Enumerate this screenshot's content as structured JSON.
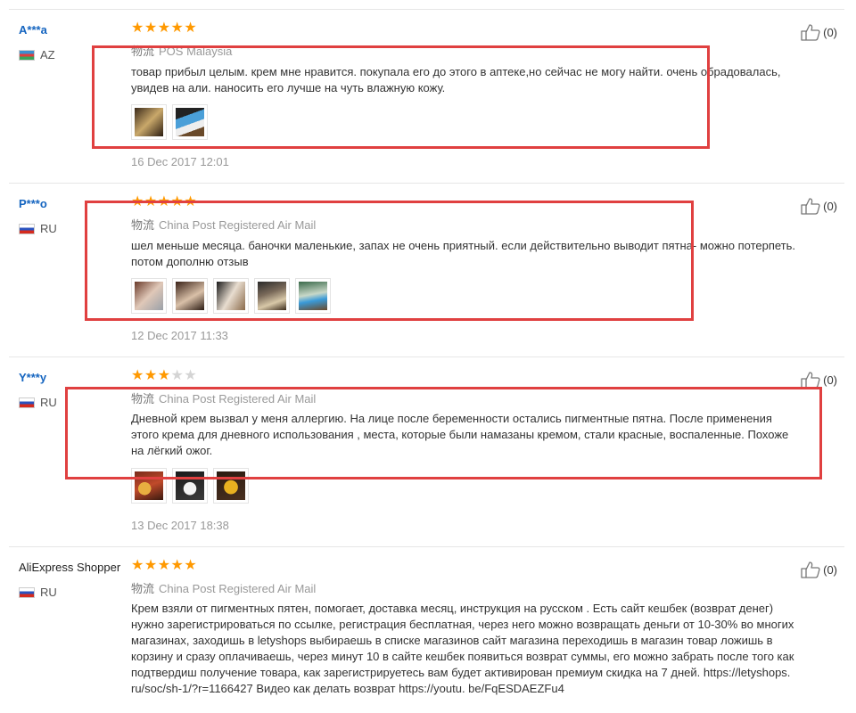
{
  "reviews": [
    {
      "user": "A***a",
      "country": "AZ",
      "rating": 5,
      "logistics_label": "物流",
      "shipping": "POS Malaysia",
      "text_lines": [
        "товар прибыл целым. крем мне нравится. покупала его до этого в аптеке,но сейчас не могу найти. очень обрадовалась,",
        "увидев на али. наносить его лучше на чуть влажную кожу."
      ],
      "date": "16 Dec 2017 12:01",
      "helpful": "(0)"
    },
    {
      "user": "P***o",
      "country": "RU",
      "rating": 5,
      "logistics_label": "物流",
      "shipping": "China Post Registered Air Mail",
      "text_lines": [
        "шел меньше месяца. баночки маленькие, запах не очень приятный. если действительно выводит пятна- можно потерпеть.",
        "потом дополню отзыв"
      ],
      "date": "12 Dec 2017 11:33",
      "helpful": "(0)"
    },
    {
      "user": "Y***y",
      "country": "RU",
      "rating": 3,
      "logistics_label": "物流",
      "shipping": "China Post Registered Air Mail",
      "text_lines": [
        "Дневной крем вызвал у меня аллергию. На лице после беременности остались пигментные пятна. После применения",
        "этого крема для дневного использования , места, которые были намазаны кремом, стали красные, воспаленные. Похоже",
        "на лёгкий ожог."
      ],
      "date": "13 Dec 2017 18:38",
      "helpful": "(0)"
    },
    {
      "user": "AliExpress Shopper",
      "country": "RU",
      "rating": 5,
      "logistics_label": "物流",
      "shipping": "China Post Registered Air Mail",
      "text_lines": [
        "Крем взяли от пигментных пятен, помогает, доставка месяц, инструкция на русском . Есть сайт кешбек (возврат денег)",
        "нужно зарегистрироваться по ссылке, регистрация бесплатная, через него можно возвращать деньги от 10-30% во многих",
        "магазинах, заходишь в letyshops выбираешь в списке магазинов сайт магазина переходишь в магазин товар ложишь в",
        "корзину и сразу оплачиваешь, через минут 10 в сайте кешбек появиться возврат суммы, его можно забрать после того как",
        "подтвердиш получение товара, как зарегистрируетесь вам будет активирован премиум скидка на 7 дней. https://letyshops.",
        "ru/soc/sh-1/?r=1166427 Видео как делать возврат https://youtu. be/FqESDAEZFu4"
      ],
      "date": "",
      "helpful": "(0)"
    }
  ],
  "colors": {
    "star_on": "#ff9900",
    "star_off": "#d4d4d4",
    "username": "#1565c0",
    "highlight_box": "#e04040"
  },
  "icons": {
    "helpful": "thumbs-up-icon",
    "star": "star-icon"
  }
}
